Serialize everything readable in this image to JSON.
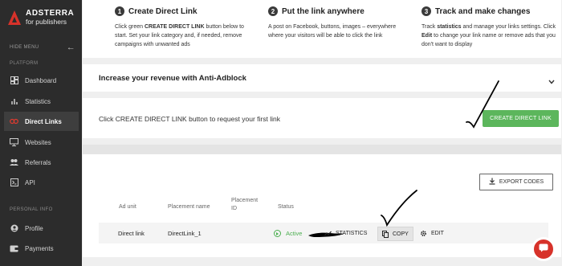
{
  "brand": {
    "name": "ADSTERRA",
    "sub": "for publishers",
    "accent": "#d7322a"
  },
  "sidebar": {
    "hide_menu": "HIDE MENU",
    "section_platform": "PLATFORM",
    "section_personal": "PERSONAL INFO",
    "items": [
      {
        "label": "Dashboard",
        "icon": "dashboard-icon"
      },
      {
        "label": "Statistics",
        "icon": "bar-chart-icon"
      },
      {
        "label": "Direct Links",
        "icon": "link-icon",
        "active": true
      },
      {
        "label": "Websites",
        "icon": "monitor-icon"
      },
      {
        "label": "Referrals",
        "icon": "people-icon"
      },
      {
        "label": "API",
        "icon": "terminal-icon"
      },
      {
        "label": "Profile",
        "icon": "user-icon"
      },
      {
        "label": "Payments",
        "icon": "wallet-icon"
      }
    ]
  },
  "steps": [
    {
      "num": "1",
      "title": "Create Direct Link",
      "desc_pre": "Click green ",
      "desc_bold": "CREATE DIRECT LINK",
      "desc_post": " button below to start. Set your link category and, if needed, remove campaigns with unwanted ads"
    },
    {
      "num": "2",
      "title": "Put the link anywhere",
      "desc_pre": "A post on Facebook, buttons, images – everywhere where your visitors will be able to click the link",
      "desc_bold": "",
      "desc_post": ""
    },
    {
      "num": "3",
      "title": "Track and make changes",
      "desc_pre": "Track ",
      "desc_bold": "statistics",
      "desc_mid": " and manage your links settings. Click ",
      "desc_bold2": "Edit",
      "desc_post": " to change your link name or remove ads that you don't want to display"
    }
  ],
  "adblock": {
    "title": "Increase your revenue with Anti-Adblock"
  },
  "request": {
    "text": "Click CREATE DIRECT LINK button to request your first link",
    "button": "CREATE DIRECT LINK",
    "button_color": "#5cb65c"
  },
  "table": {
    "export_label": "EXPORT CODES",
    "headers": {
      "ad_unit": "Ad unit",
      "placement_name": "Placement name",
      "placement_id_1": "Placement",
      "placement_id_2": "ID",
      "status": "Status"
    },
    "row": {
      "ad_unit": "Direct link",
      "placement_name": "DirectLink_1",
      "status": "Active",
      "status_color": "#4caf50"
    },
    "actions": {
      "statistics": "STATISTICS",
      "copy": "COPY",
      "edit": "EDIT"
    }
  }
}
